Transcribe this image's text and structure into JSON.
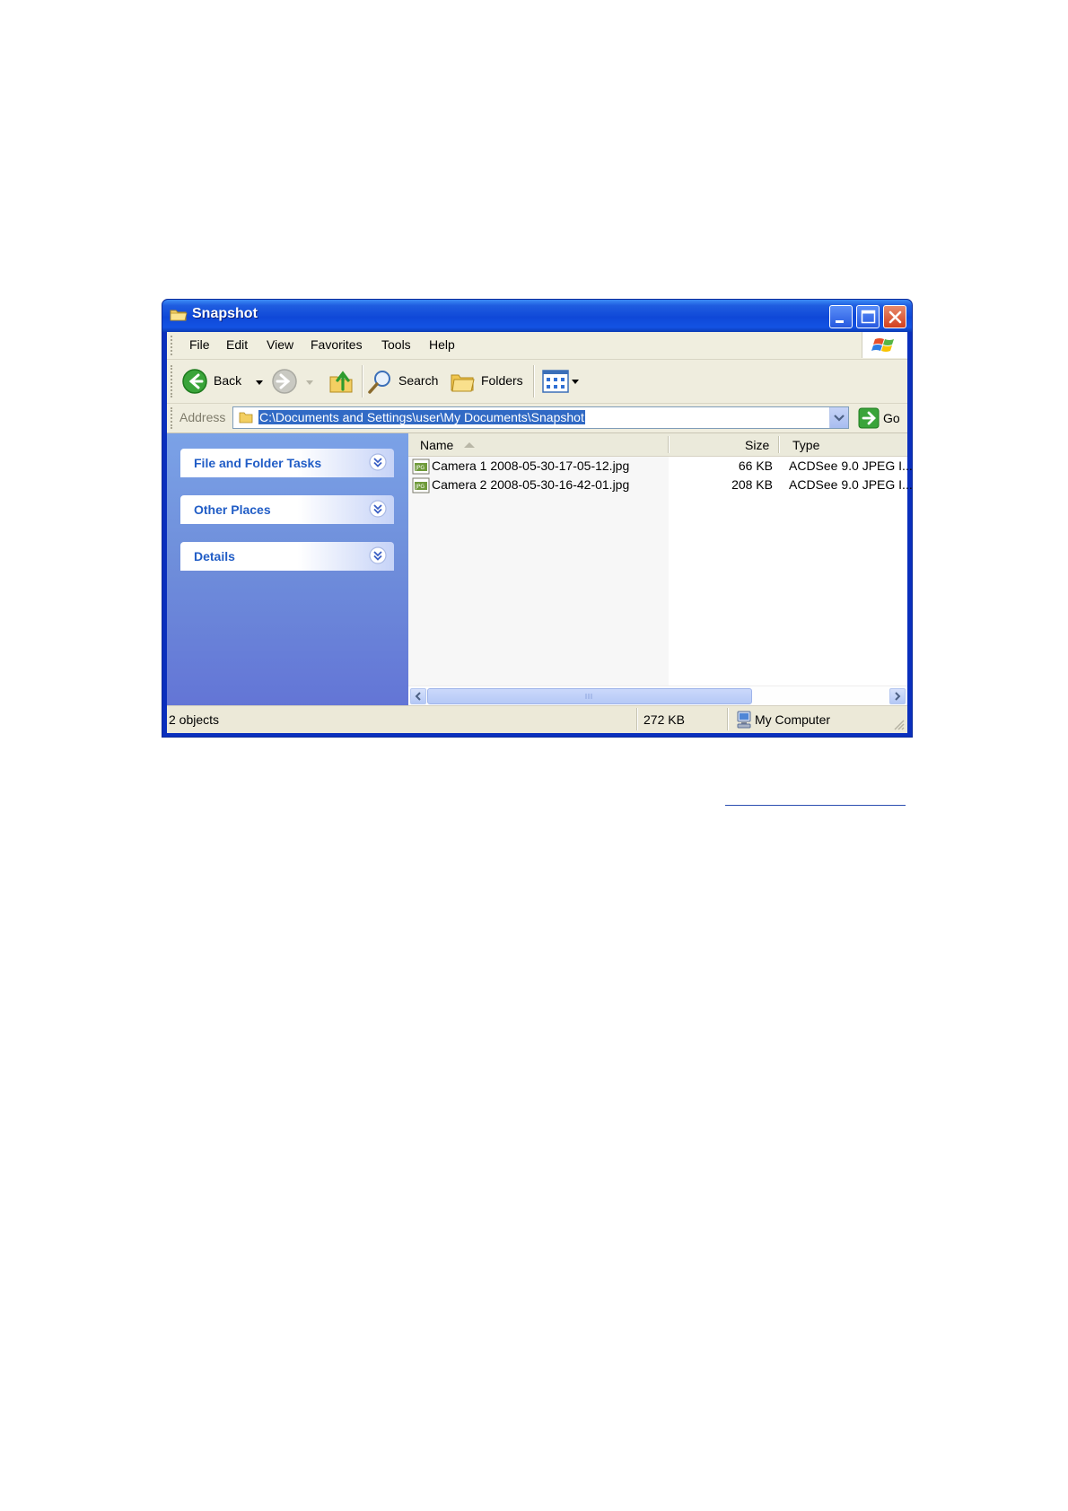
{
  "window": {
    "title": "Snapshot"
  },
  "menu": [
    "File",
    "Edit",
    "View",
    "Favorites",
    "Tools",
    "Help"
  ],
  "toolbar": {
    "back_label": "Back",
    "search_label": "Search",
    "folders_label": "Folders"
  },
  "address": {
    "label": "Address",
    "value": "C:\\Documents and Settings\\user\\My Documents\\Snapshot",
    "go_label": "Go"
  },
  "task_panes": [
    {
      "title": "File and Folder Tasks"
    },
    {
      "title": "Other Places"
    },
    {
      "title": "Details"
    }
  ],
  "columns": {
    "name": "Name",
    "size": "Size",
    "type": "Type"
  },
  "files": [
    {
      "name": "Camera 1 2008-05-30-17-05-12.jpg",
      "size": "66 KB",
      "type": "ACDSee 9.0 JPEG I..."
    },
    {
      "name": "Camera 2 2008-05-30-16-42-01.jpg",
      "size": "208 KB",
      "type": "ACDSee 9.0 JPEG I..."
    }
  ],
  "status": {
    "objects": "2 objects",
    "total_size": "272 KB",
    "location": "My Computer"
  },
  "colors": {
    "titlebar": "#0f48d8",
    "taskpane": "#6f8fdb",
    "selection": "#316ac5",
    "panel_title": "#215dc6"
  }
}
